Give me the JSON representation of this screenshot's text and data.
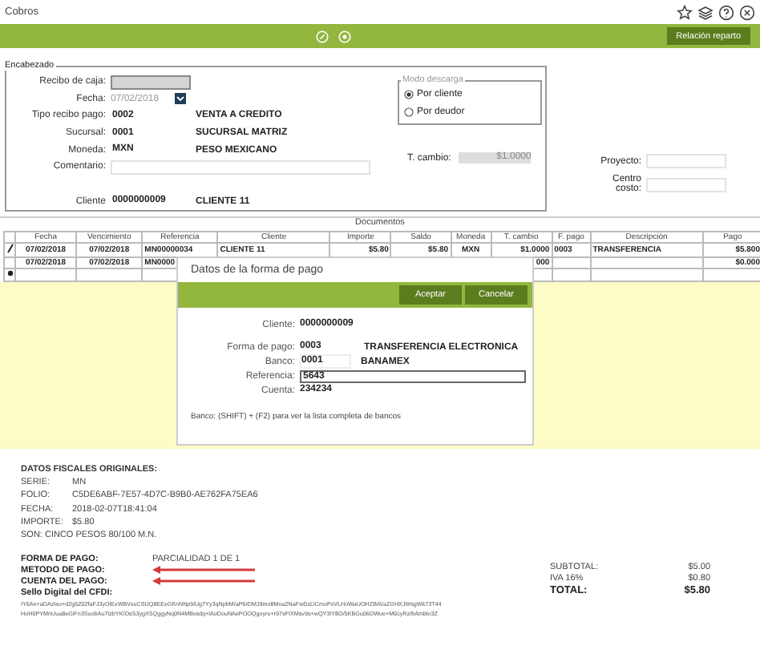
{
  "window": {
    "title": "Cobros"
  },
  "toolbar": {
    "action": "Relación reparto"
  },
  "header": {
    "legend": "Encabezado",
    "fields": [
      {
        "kind": "readonly",
        "label": "Recibo de caja:"
      },
      {
        "kind": "date",
        "label": "Fecha:",
        "value": "07/02/2018"
      },
      {
        "kind": "text",
        "label": "Tipo recibo pago:",
        "value": "0002",
        "description": "VENTA A CREDITO"
      },
      {
        "kind": "text",
        "label": "Sucursal:",
        "value": "0001",
        "description": "SUCURSAL MATRIZ"
      },
      {
        "kind": "text",
        "label": "Moneda:",
        "value": "MXN",
        "description": "PESO MEXICANO"
      },
      {
        "kind": "wide",
        "label": "Comentario:"
      },
      {
        "kind": "spaced",
        "label": "Cliente",
        "value": "0000000009",
        "description": "CLIENTE 11"
      }
    ],
    "mode": {
      "legend": "Modo descarga",
      "options": [
        {
          "label": "Por cliente",
          "selected": true
        },
        {
          "label": "Por deudor",
          "selected": false
        }
      ]
    },
    "exchange": {
      "label": "T. cambio:",
      "value": "$1.0000"
    },
    "side_fields": [
      {
        "label": "Proyecto:"
      },
      {
        "label": "Centro costo:"
      }
    ]
  },
  "documents": {
    "title": "Documentos",
    "columns": [
      "Fecha",
      "Vencimiento",
      "Referencia",
      "Cliente",
      "Importe",
      "Saldo",
      "Moneda",
      "T. cambio",
      "F. pago",
      "Descripción",
      "Pago"
    ],
    "rows": [
      {
        "kind": "edit",
        "cells": [
          "07/02/2018",
          "07/02/2018",
          "MN00000034",
          "CLIENTE 11",
          "$5.80",
          "$5.80",
          "MXN",
          "$1.0000",
          "0003",
          "TRANSFERENCIA",
          "$5.800"
        ]
      },
      {
        "cells": [
          "07/02/2018",
          "07/02/2018",
          "MN0000",
          "",
          "",
          "",
          "",
          "000",
          "",
          "",
          "$0.000"
        ]
      },
      {
        "kind": "new",
        "cells": [
          "",
          "",
          "",
          "",
          "",
          "",
          "",
          "",
          "",
          "",
          ""
        ]
      }
    ]
  },
  "dialog": {
    "title": "Datos de la forma de pago",
    "buttons": [
      "Aceptar",
      "Cancelar"
    ],
    "fields": [
      {
        "label": "Cliente:",
        "value": "0000000009"
      },
      {
        "label": "Forma de pago:",
        "value": "0003",
        "description": "TRANSFERENCIA ELECTRONICA"
      },
      {
        "label": "Banco:",
        "value": "0001",
        "description": "BANAMEX",
        "kind": "box"
      },
      {
        "label": "Referencia:",
        "value": "5643",
        "kind": "focused"
      },
      {
        "label": "Cuenta:",
        "value": "234234"
      }
    ],
    "hint": "Banco: (SHIFT) + (F2) para ver la lista completa de bancos"
  },
  "fiscal": {
    "heading": "DATOS FISCALES ORIGINALES:",
    "items": [
      {
        "label": "SERIE:",
        "value": "MN"
      },
      {
        "label": "FOLIO:",
        "value": "C5DE6ABF-7E57-4D7C-B9B0-AE762FA75EA6"
      },
      {
        "label": "FECHA:",
        "value": "2018-02-07T18:41:04"
      },
      {
        "label": "IMPORTE:",
        "value": "$5.80"
      }
    ],
    "amount_words": "SON: CINCO PESOS 80/100 M.N.",
    "payment": [
      {
        "label": "FORMA DE PAGO:",
        "value": "PARCIALIDAD 1 DE 1",
        "arrow": false
      },
      {
        "label": "METODO DE PAGO:",
        "arrow": true
      },
      {
        "label": "CUENTA DEL PAGO:",
        "arrow": true
      },
      {
        "label": "Sello Digital del CFDI:",
        "arrow": false
      }
    ],
    "totals": [
      {
        "label": "SUBTOTAL:",
        "value": "$5.00",
        "bold": false
      },
      {
        "label": "IVA 16%",
        "value": "$0.80",
        "bold": false
      },
      {
        "label": "TOTAL:",
        "value": "$5.80",
        "bold": true
      }
    ],
    "seal": [
      "IY6An+aDAzIso+d2g5Z02faFJ3yOlExWBVxuCSUQ8EExGKnNNp5lUg7Yy3qNpbM/aP6rDMJ9mo8Moa2NaFwDzLlCmoPxVLHoWaUOHZB/6/aZGHXJWsgWk73T44",
      "HoH0PYMnUua8eGiFn3SuobAu7tzbYK/OsS3ygXSQggyNq0N4MBvsdq+lAoDouNAePOOQgoyru+r97sFIXMsv9s+wQY3IY8O/5KBGu06OWue+M0cyRz/bAmblo3Z"
    ]
  }
}
